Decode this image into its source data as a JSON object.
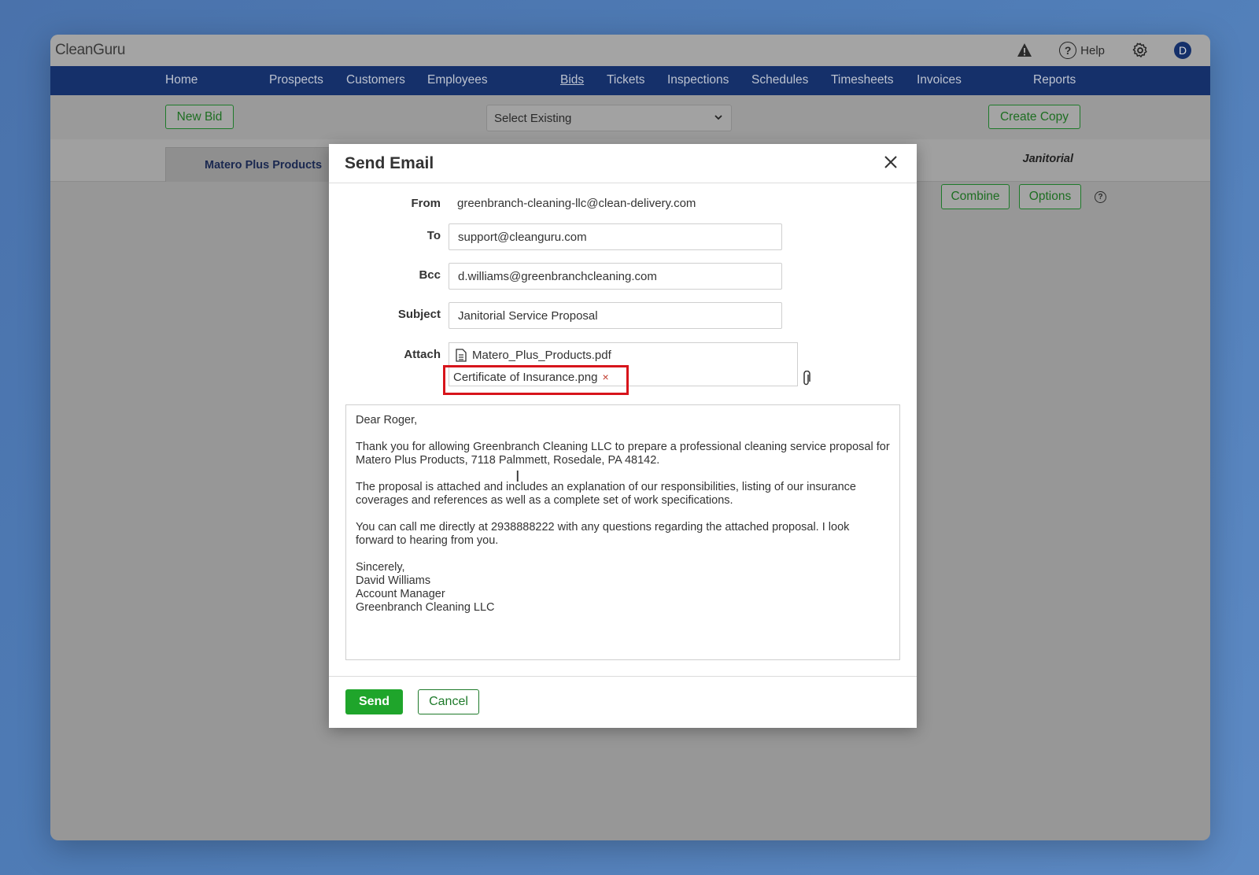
{
  "app": {
    "logo": "CleanGuru"
  },
  "topbar": {
    "help_label": "Help",
    "avatar_initial": "D"
  },
  "nav": {
    "items": [
      "Home",
      "Prospects",
      "Customers",
      "Employees",
      "Bids",
      "Tickets",
      "Inspections",
      "Schedules",
      "Timesheets",
      "Invoices",
      "Reports"
    ],
    "active": "Bids"
  },
  "toolbar": {
    "new_bid_label": "New Bid",
    "select_value": "Select Existing",
    "create_copy_label": "Create Copy"
  },
  "subbar": {
    "active_tab": "Matero Plus Products",
    "category": "Janitorial",
    "combine_label": "Combine",
    "options_label": "Options",
    "help_mark": "?"
  },
  "modal": {
    "title": "Send Email",
    "from_label": "From",
    "from_value": "greenbranch-cleaning-llc@clean-delivery.com",
    "to_label": "To",
    "to_value": "support@cleanguru.com",
    "bcc_label": "Bcc",
    "bcc_value": "d.williams@greenbranchcleaning.com",
    "subject_label": "Subject",
    "subject_value": "Janitorial Service Proposal",
    "attach_label": "Attach",
    "attachments": [
      "Matero_Plus_Products.pdf",
      "Certificate of Insurance.png"
    ],
    "remove_mark": "×",
    "body": {
      "greeting": "Dear Roger,",
      "p1": "Thank you for allowing Greenbranch Cleaning LLC to prepare a professional cleaning service proposal for Matero Plus Products, 7118 Palmmett, Rosedale, PA 48142.",
      "p2": "The proposal is attached and includes an explanation of our responsibilities, listing of our insurance coverages and references as well as a complete set of work specifications.",
      "p3": "You can call me directly at 2938888222 with any questions regarding the attached proposal.  I look forward to hearing from you.",
      "sign1": "Sincerely,",
      "sign2": "David Williams",
      "sign3": "Account Manager",
      "sign4": "Greenbranch Cleaning LLC"
    },
    "send_label": "Send",
    "cancel_label": "Cancel"
  }
}
